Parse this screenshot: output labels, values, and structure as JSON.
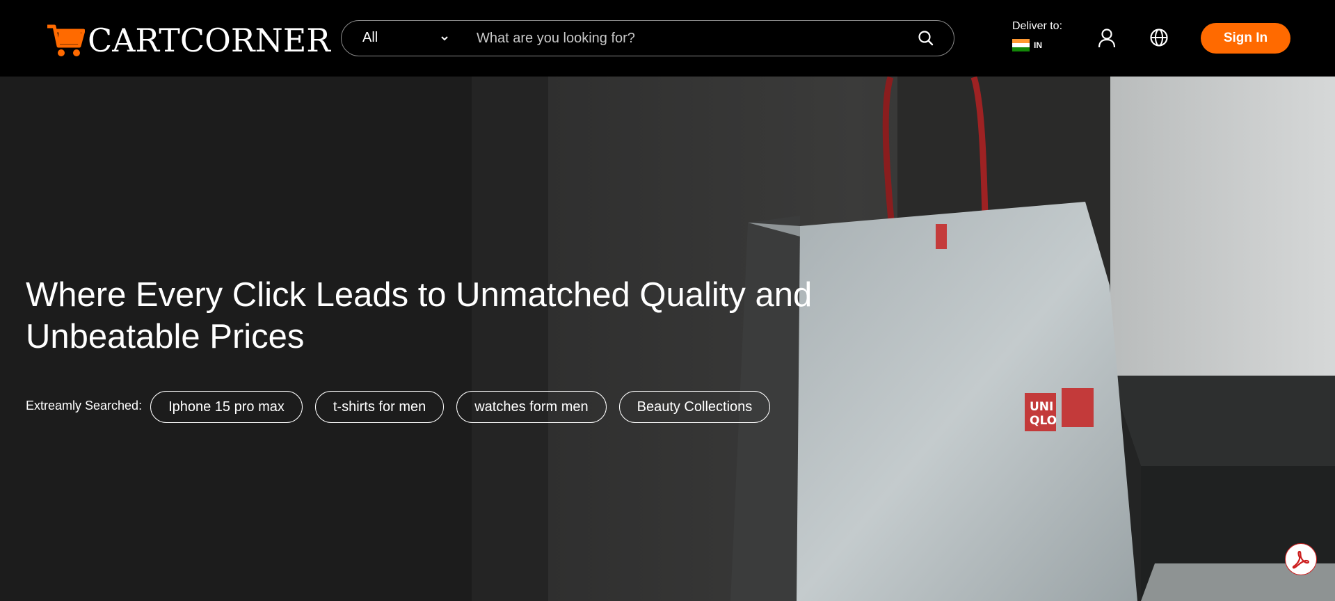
{
  "brand": {
    "name": "CARTCORNER",
    "accent": "#ff6a00"
  },
  "search": {
    "category": "All",
    "placeholder": "What are you looking for?"
  },
  "deliver": {
    "label": "Deliver to:",
    "country_code": "IN",
    "flag_icon": "india-flag-icon"
  },
  "header_actions": {
    "user_icon": "user-icon",
    "language_icon": "globe-icon",
    "sign_in_label": "Sign In"
  },
  "hero": {
    "headline": "Where Every Click Leads to Unmatched Quality and Unbeatable Prices",
    "searched_label": "Extreamly Searched:",
    "chips": [
      "Iphone 15 pro max",
      "t-shirts for men",
      "watches form men",
      "Beauty Collections"
    ]
  },
  "floating": {
    "pdf_icon": "acrobat-pdf-icon"
  }
}
